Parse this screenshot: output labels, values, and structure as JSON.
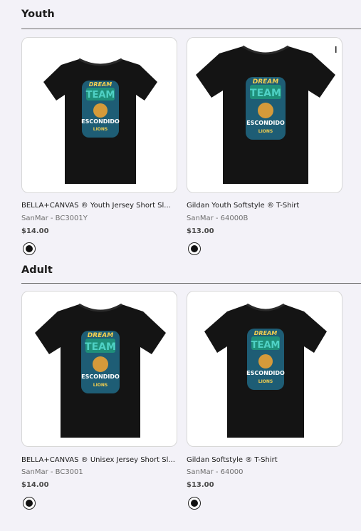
{
  "sections": [
    {
      "title": "Youth",
      "products": [
        {
          "name": "BELLA+CANVAS ® Youth Jersey Short Sl...",
          "sku": "SanMar - BC3001Y",
          "price": "$14.00",
          "swatch_color": "#111111"
        },
        {
          "name": "Gildan Youth Softstyle ® T-Shirt",
          "sku": "SanMar - 64000B",
          "price": "$13.00",
          "swatch_color": "#111111"
        }
      ]
    },
    {
      "title": "Adult",
      "products": [
        {
          "name": "BELLA+CANVAS ® Unisex Jersey Short Sl...",
          "sku": "SanMar - BC3001",
          "price": "$14.00",
          "swatch_color": "#111111"
        },
        {
          "name": "Gildan Softstyle ® T-Shirt",
          "sku": "SanMar - 64000",
          "price": "$13.00",
          "swatch_color": "#111111"
        }
      ]
    }
  ],
  "print_graphic": {
    "line1": "DREAM",
    "line2": "TEAM",
    "line3": "ESCONDIDO",
    "line4": "LIONS"
  }
}
